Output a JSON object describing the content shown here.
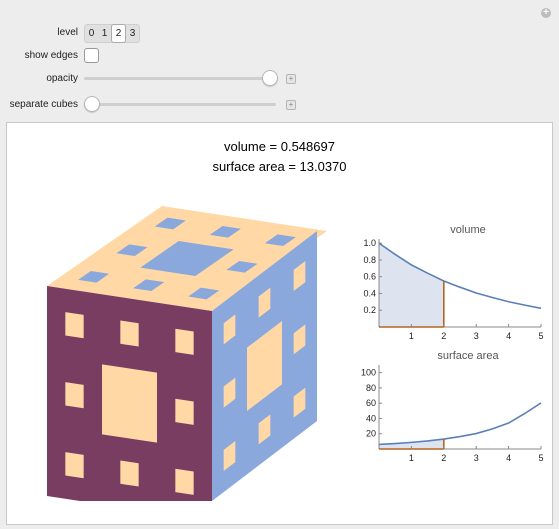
{
  "controls": {
    "level_label": "level",
    "level_options": [
      "0",
      "1",
      "2",
      "3"
    ],
    "level_selected": "2",
    "show_edges_label": "show edges",
    "show_edges_checked": false,
    "opacity_label": "opacity",
    "opacity_value": 1.0,
    "separate_label": "separate cubes",
    "separate_value": 0.0,
    "plus_glyph": "+"
  },
  "readouts": {
    "volume": "volume = 0.548697",
    "surface": "surface area = 13.0370"
  },
  "colors": {
    "face_top": "#ffd8a6",
    "face_left": "#7a3d62",
    "face_right": "#8aa8dc",
    "curve": "#5b80b8",
    "marker": "#b5651d",
    "fill": "#dde4ef"
  },
  "chart_data": [
    {
      "type": "area",
      "title": "volume",
      "x": [
        0,
        0.5,
        1,
        1.5,
        2,
        2.5,
        3,
        3.5,
        4,
        4.5,
        5
      ],
      "y": [
        1.0,
        0.866,
        0.741,
        0.642,
        0.549,
        0.475,
        0.406,
        0.352,
        0.301,
        0.261,
        0.223
      ],
      "xticks": [
        "1",
        "2",
        "3",
        "4",
        "5"
      ],
      "yticks": [
        "0.2",
        "0.4",
        "0.6",
        "0.8",
        "1.0"
      ],
      "xlim": [
        0,
        5
      ],
      "ylim": [
        0,
        1.05
      ],
      "marker_x": 2,
      "marker_y": 0.549,
      "grid": false
    },
    {
      "type": "area",
      "title": "surface area",
      "x": [
        0,
        0.5,
        1,
        1.5,
        2,
        2.5,
        3,
        3.5,
        4,
        4.5,
        5
      ],
      "y": [
        6.0,
        7.17,
        8.67,
        10.6,
        13.04,
        16.3,
        20.2,
        26.3,
        34.0,
        46.5,
        60.3
      ],
      "xticks": [
        "1",
        "2",
        "3",
        "4",
        "5"
      ],
      "yticks": [
        "20",
        "40",
        "60",
        "80",
        "100"
      ],
      "xlim": [
        0,
        5
      ],
      "ylim": [
        0,
        110
      ],
      "marker_x": 2,
      "marker_y": 13.04,
      "grid": false
    }
  ]
}
